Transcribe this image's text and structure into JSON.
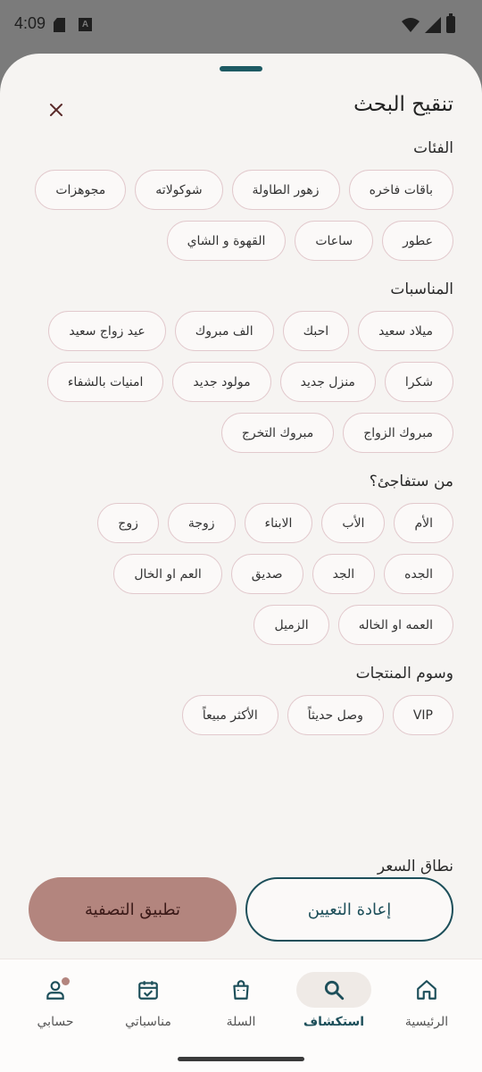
{
  "status_bar": {
    "time": "4:09",
    "a_icon": "A"
  },
  "sheet": {
    "title": "تنقيح البحث",
    "sections": [
      {
        "title": "الفئات",
        "chips": [
          "باقات فاخره",
          "زهور الطاولة",
          "شوكولاته",
          "مجوهزات",
          "عطور",
          "ساعات",
          "القهوة و الشاي"
        ]
      },
      {
        "title": "المناسبات",
        "chips": [
          "ميلاد سعيد",
          "احبك",
          "الف مبروك",
          "عيد زواج سعيد",
          "شكرا",
          "منزل جديد",
          "مولود جديد",
          "امنيات بالشفاء",
          "مبروك الزواج",
          "مبروك التخرج"
        ]
      },
      {
        "title": "من ستفاجئ؟",
        "chips": [
          "الأم",
          "الأب",
          "الابناء",
          "زوجة",
          "زوج",
          "الجده",
          "الجد",
          "صديق",
          "العم او الخال",
          "العمه او الخاله",
          "الزميل"
        ]
      },
      {
        "title": "وسوم المنتجات",
        "chips": [
          "VIP",
          "وصل حديثاً",
          "الأكثر مبيعاً"
        ]
      }
    ],
    "cut_title": "نطاق السعر",
    "reset_label": "إعادة التعيين",
    "apply_label": "تطبيق التصفية"
  },
  "nav": {
    "items": [
      {
        "label": "الرئيسية",
        "icon": "home-icon",
        "active": false
      },
      {
        "label": "استكشاف",
        "icon": "search-icon",
        "active": true
      },
      {
        "label": "السلة",
        "icon": "bag-icon",
        "active": false
      },
      {
        "label": "مناسباتي",
        "icon": "calendar-icon",
        "active": false
      },
      {
        "label": "حسابي",
        "icon": "person-icon",
        "active": false
      }
    ]
  },
  "colors": {
    "accent": "#1d4f5a",
    "apply": "#b3857e",
    "chip_border": "#e2c9cd",
    "sheet_bg": "#f6f4f2"
  }
}
